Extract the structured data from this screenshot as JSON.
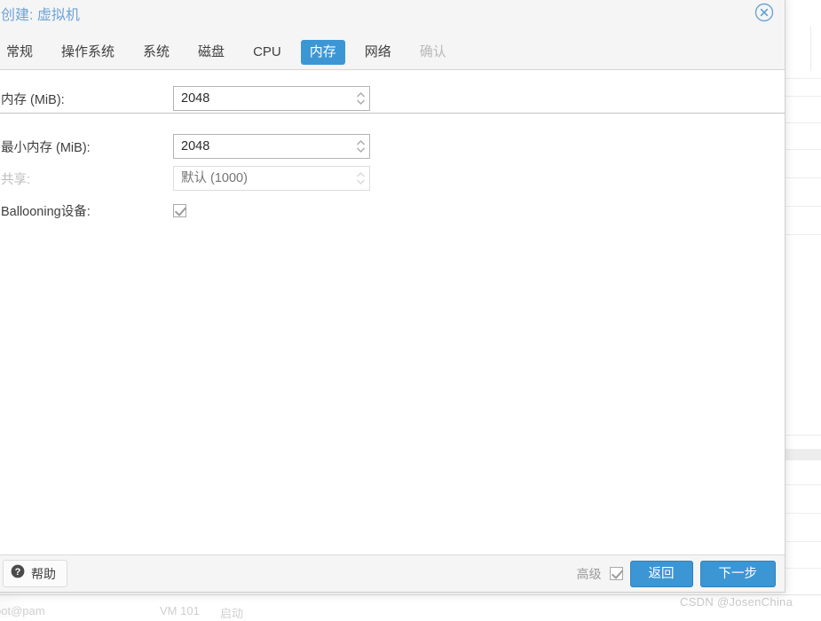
{
  "background": {
    "user_text": "oot@pam",
    "vmid_text": "VM 101",
    "task_text": "启动"
  },
  "watermark": {
    "text": "CSDN @JosenChina"
  },
  "dialog": {
    "title": "创建: 虚拟机",
    "close_icon": "close-circle-icon",
    "tabs": [
      {
        "label": "常规",
        "state": "normal"
      },
      {
        "label": "操作系统",
        "state": "normal"
      },
      {
        "label": "系统",
        "state": "normal"
      },
      {
        "label": "磁盘",
        "state": "normal"
      },
      {
        "label": "CPU",
        "state": "normal"
      },
      {
        "label": "内存",
        "state": "active"
      },
      {
        "label": "网络",
        "state": "normal"
      },
      {
        "label": "确认",
        "state": "disabled"
      }
    ],
    "fields": {
      "memory": {
        "label": "内存 (MiB):",
        "value": "2048",
        "placeholder": "",
        "enabled": true
      },
      "min_memory": {
        "label": "最小内存 (MiB):",
        "value": "2048",
        "placeholder": "",
        "enabled": true
      },
      "shares": {
        "label": "共享:",
        "value": "",
        "placeholder": "默认 (1000)",
        "enabled": false
      },
      "ballooning": {
        "label": "Ballooning设备:",
        "checked": true
      }
    },
    "footer": {
      "help_label": "帮助",
      "help_icon": "question-mark-circle-icon",
      "advanced_label": "高级",
      "advanced_checked": true,
      "back_label": "返回",
      "next_label": "下一步"
    }
  },
  "colors": {
    "accent": "#3c96d4",
    "title_blue": "#6ea4d8",
    "header_bg": "#f5f5f5",
    "text": "#3f3f3f",
    "disabled_text": "#bcbcbc"
  }
}
